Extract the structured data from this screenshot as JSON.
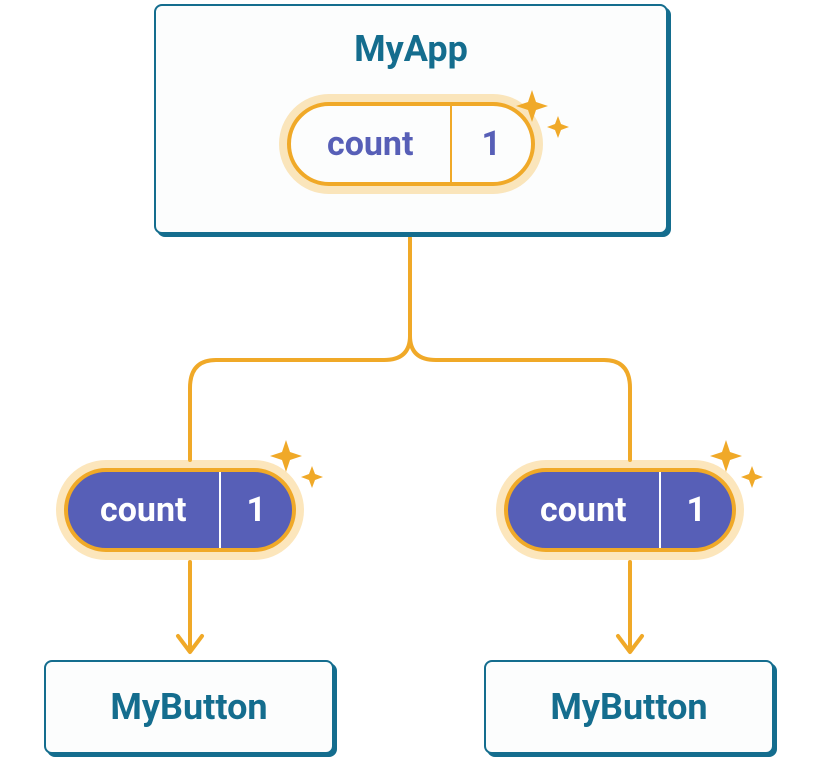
{
  "parent": {
    "title": "MyApp",
    "state": {
      "label": "count",
      "value": "1"
    }
  },
  "props": {
    "left": {
      "label": "count",
      "value": "1"
    },
    "right": {
      "label": "count",
      "value": "1"
    }
  },
  "children": {
    "left": {
      "title": "MyButton"
    },
    "right": {
      "title": "MyButton"
    }
  },
  "colors": {
    "border_teal": "#146d8e",
    "accent_orange": "#f0a928",
    "pill_purple": "#575fb7"
  }
}
